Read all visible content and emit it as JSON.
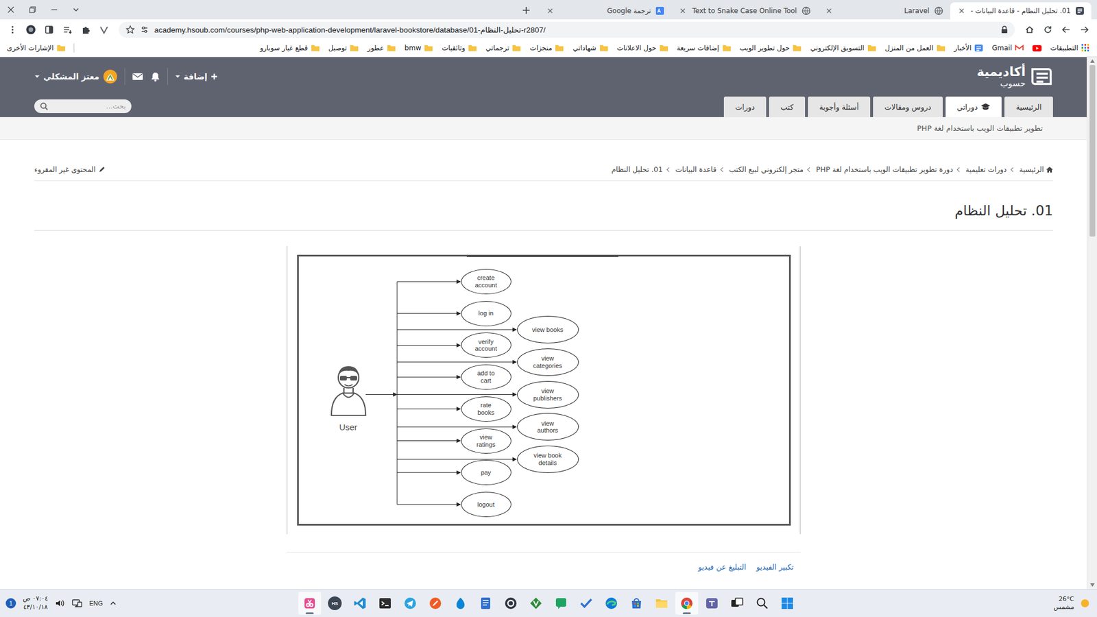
{
  "browser": {
    "tabs": [
      {
        "label": "01. تحليل النظام - قاعدة البيانات -",
        "selected": true,
        "kind": "hsoub"
      },
      {
        "label": "Laravel",
        "selected": false,
        "kind": "globe"
      },
      {
        "label": "Text to Snake Case Online Tool",
        "selected": false,
        "kind": "globe"
      },
      {
        "label": "ترجمة Google",
        "selected": false,
        "kind": "translate"
      }
    ],
    "url": "academy.hsoub.com/courses/php-web-application-development/laravel-bookstore/database/01-تحليل-النظام-r2807/",
    "bookmarks": [
      {
        "label": "التطبيقات",
        "kind": "apps"
      },
      {
        "kind": "youtube"
      },
      {
        "label": "Gmail",
        "kind": "gmail"
      },
      {
        "label": "الأخبار",
        "kind": "news"
      },
      {
        "label": "العمل من المنزل",
        "kind": "folder"
      },
      {
        "label": "التسويق الإلكتروني",
        "kind": "folder"
      },
      {
        "label": "حول تطوير الويب",
        "kind": "folder"
      },
      {
        "label": "إضافات سريعة",
        "kind": "folder"
      },
      {
        "label": "حول الاعلانات",
        "kind": "folder"
      },
      {
        "label": "شهاداتي",
        "kind": "folder"
      },
      {
        "label": "منجزات",
        "kind": "folder"
      },
      {
        "label": "ترجماتي",
        "kind": "folder"
      },
      {
        "label": "وثائقيات",
        "kind": "folder"
      },
      {
        "label": "bmw",
        "kind": "folder"
      },
      {
        "label": "عطور",
        "kind": "folder"
      },
      {
        "label": "توصيل",
        "kind": "folder"
      },
      {
        "label": "قطع غيار سوبارو",
        "kind": "folder"
      }
    ],
    "other_bookmarks": "الإشارات الأخرى"
  },
  "site": {
    "logo": {
      "title": "أكاديمية",
      "subtitle": "حسوب"
    },
    "user": "معتز المشكلي",
    "add": "إضافة",
    "nav": [
      {
        "label": "الرئيسية",
        "selected": false,
        "kind": "text"
      },
      {
        "label": "دوراتي",
        "selected": true,
        "kind": "icon"
      },
      {
        "label": "دروس ومقالات",
        "selected": false,
        "kind": "text"
      },
      {
        "label": "أسئلة وأجوبة",
        "selected": false,
        "kind": "text"
      },
      {
        "label": "كتب",
        "selected": false,
        "kind": "text"
      },
      {
        "label": "دورات",
        "selected": false,
        "kind": "text"
      }
    ],
    "search": {
      "placeholder": "بحث..."
    },
    "section": "تطوير تطبيقات الويب باستخدام لغة PHP"
  },
  "breadcrumb": [
    {
      "label": "الرئيسية",
      "kind": "home"
    },
    {
      "label": "دورات تعليمية",
      "kind": "text"
    },
    {
      "label": "دورة تطوير تطبيقات الويب باستخدام لغة PHP",
      "kind": "text"
    },
    {
      "label": "متجر إلكتروني لبيع الكتب",
      "kind": "text"
    },
    {
      "label": "قاعدة البيانات",
      "kind": "text"
    },
    {
      "label": "01. تحليل النظام",
      "kind": "text"
    }
  ],
  "unread": "المحتوى غير المقروء",
  "title": "01. تحليل النظام",
  "diagram": {
    "actor": "User",
    "left_cases": [
      "create account",
      "log in",
      "verify account",
      "add to cart",
      "rate books",
      "view ratings",
      "pay",
      "logout"
    ],
    "right_cases": [
      "view books",
      "view categories",
      "view publishers",
      "view authors",
      "view book details"
    ]
  },
  "video_links": [
    "تكبير الفيديو",
    "التبليغ عن فيديو"
  ],
  "taskbar": {
    "weather": {
      "temperature": "26°C",
      "condition": "مشمس"
    },
    "apps": [
      {
        "kind": "start",
        "running": false
      },
      {
        "kind": "search",
        "running": false
      },
      {
        "kind": "taskview",
        "running": false
      },
      {
        "kind": "teams",
        "running": false
      },
      {
        "kind": "chrome",
        "running": true
      },
      {
        "kind": "explorer",
        "running": false
      },
      {
        "kind": "store",
        "running": false
      },
      {
        "kind": "edge",
        "running": false
      },
      {
        "kind": "todo",
        "running": false
      },
      {
        "kind": "chat",
        "running": false
      },
      {
        "kind": "vim",
        "running": false
      },
      {
        "kind": "disk",
        "running": false
      },
      {
        "kind": "notepad",
        "running": false
      },
      {
        "kind": "edgebeta",
        "running": false
      },
      {
        "kind": "postman",
        "running": false
      },
      {
        "kind": "telegram",
        "running": false
      },
      {
        "kind": "terminal",
        "running": false
      },
      {
        "kind": "vscode",
        "running": false
      },
      {
        "kind": "hs",
        "label": "HS",
        "running": false
      },
      {
        "kind": "snip",
        "running": true
      }
    ],
    "language": "ENG",
    "time": "٠٧:٠٤ ص",
    "date": "٤٣/١٠/١٨",
    "notifications": "1"
  }
}
